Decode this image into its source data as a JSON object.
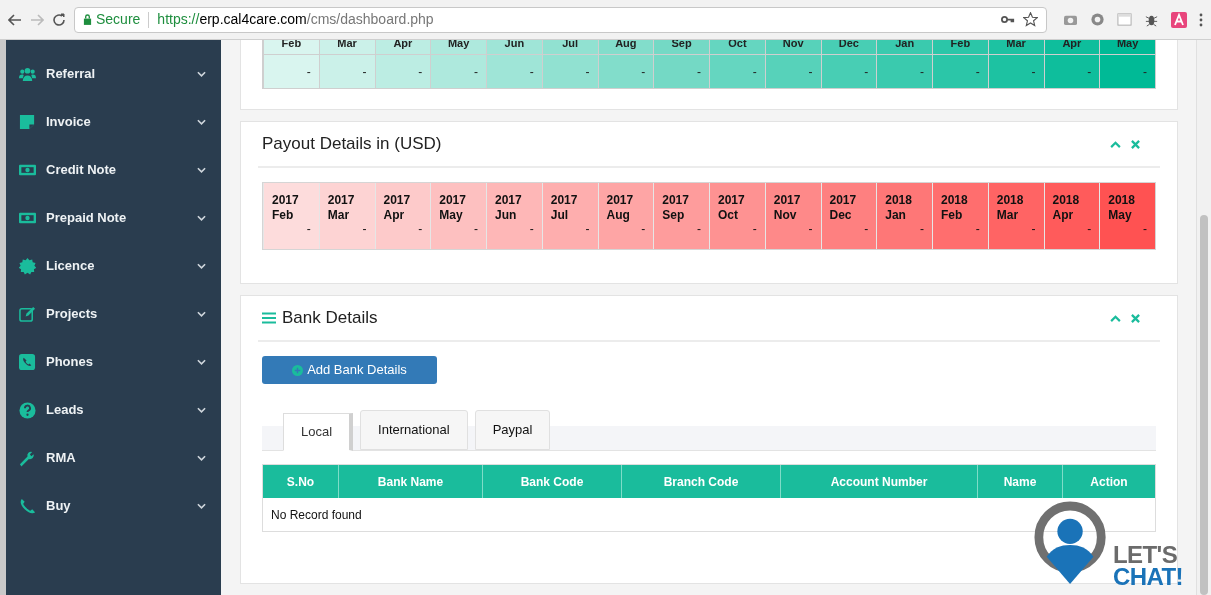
{
  "browser": {
    "secure_label": "Secure",
    "url_scheme": "https://",
    "url_host": "erp.cal4care.com",
    "url_path": "/cms/dashboard.php"
  },
  "sidebar": {
    "items": [
      {
        "label": "Referral",
        "kind": "users"
      },
      {
        "label": "Invoice",
        "kind": "note"
      },
      {
        "label": "Credit Note",
        "kind": "money"
      },
      {
        "label": "Prepaid Note",
        "kind": "money"
      },
      {
        "label": "Licence",
        "kind": "badge"
      },
      {
        "label": "Projects",
        "kind": "edit"
      },
      {
        "label": "Phones",
        "kind": "phonebox"
      },
      {
        "label": "Leads",
        "kind": "question"
      },
      {
        "label": "RMA",
        "kind": "wrench"
      },
      {
        "label": "Buy",
        "kind": "phone"
      }
    ]
  },
  "top_table": {
    "months": [
      "Feb",
      "Mar",
      "Apr",
      "May",
      "Jun",
      "Jul",
      "Aug",
      "Sep",
      "Oct",
      "Nov",
      "Dec",
      "Jan",
      "Feb",
      "Mar",
      "Apr",
      "May"
    ],
    "values": [
      "-",
      "-",
      "-",
      "-",
      "-",
      "-",
      "-",
      "-",
      "-",
      "-",
      "-",
      "-",
      "-",
      "-",
      "-",
      "-"
    ]
  },
  "payout": {
    "title": "Payout Details in (USD)",
    "cells": [
      {
        "year": "2017",
        "month": "Feb",
        "value": "-"
      },
      {
        "year": "2017",
        "month": "Mar",
        "value": "-"
      },
      {
        "year": "2017",
        "month": "Apr",
        "value": "-"
      },
      {
        "year": "2017",
        "month": "May",
        "value": "-"
      },
      {
        "year": "2017",
        "month": "Jun",
        "value": "-"
      },
      {
        "year": "2017",
        "month": "Jul",
        "value": "-"
      },
      {
        "year": "2017",
        "month": "Aug",
        "value": "-"
      },
      {
        "year": "2017",
        "month": "Sep",
        "value": "-"
      },
      {
        "year": "2017",
        "month": "Oct",
        "value": "-"
      },
      {
        "year": "2017",
        "month": "Nov",
        "value": "-"
      },
      {
        "year": "2017",
        "month": "Dec",
        "value": "-"
      },
      {
        "year": "2018",
        "month": "Jan",
        "value": "-"
      },
      {
        "year": "2018",
        "month": "Feb",
        "value": "-"
      },
      {
        "year": "2018",
        "month": "Mar",
        "value": "-"
      },
      {
        "year": "2018",
        "month": "Apr",
        "value": "-"
      },
      {
        "year": "2018",
        "month": "May",
        "value": "-"
      }
    ]
  },
  "bank": {
    "title": "Bank Details",
    "add_button": "Add Bank Details",
    "tabs": [
      {
        "label": "Local",
        "selected": true
      },
      {
        "label": "International",
        "selected": false
      },
      {
        "label": "Paypal",
        "selected": false
      }
    ],
    "columns": [
      "S.No",
      "Bank Name",
      "Bank Code",
      "Branch Code",
      "Account Number",
      "Name",
      "Action"
    ],
    "empty_message": "No Record found"
  },
  "chat_widget": {
    "line_1": "LET'S",
    "line_2": "CHAT!"
  }
}
